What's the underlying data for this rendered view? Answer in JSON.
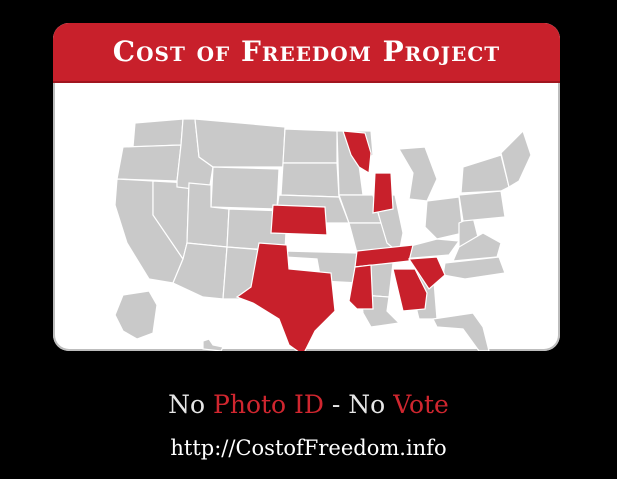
{
  "header": {
    "title": "Cost of Freedom Project"
  },
  "tagline": {
    "part1": "No ",
    "part2": "Photo ID",
    "part3": " - No ",
    "part4": "Vote"
  },
  "footer": {
    "url": "http://CostofFreedom.info"
  },
  "map": {
    "highlighted_states": [
      "Wisconsin",
      "Indiana",
      "Kansas",
      "Texas",
      "Tennessee",
      "Mississippi",
      "Georgia",
      "South Carolina"
    ],
    "colors": {
      "highlight": "#c8202b",
      "base": "#c9c9c9",
      "header": "#c8202b"
    }
  }
}
